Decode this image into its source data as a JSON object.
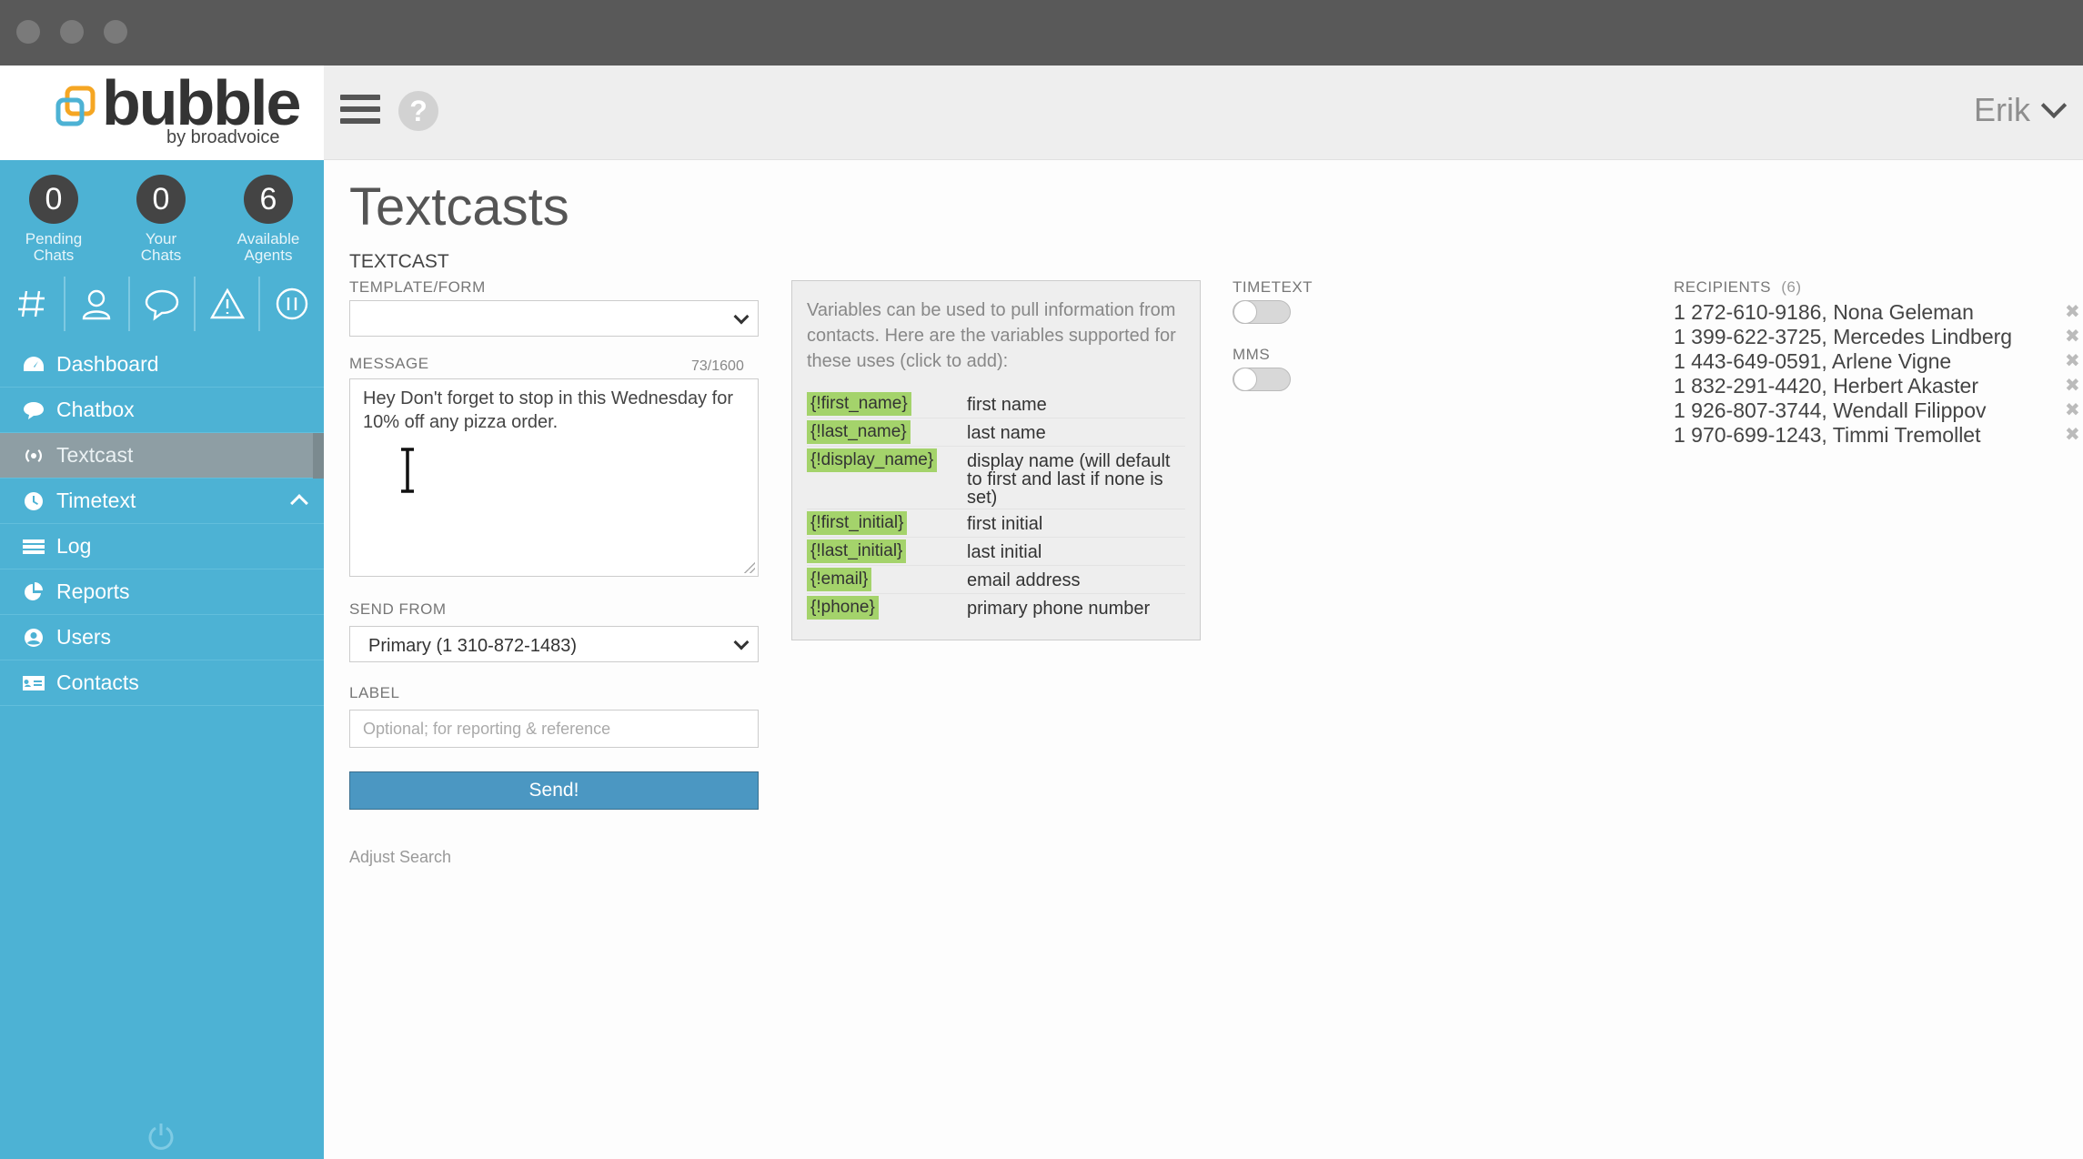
{
  "header": {
    "logo_text": "bubble",
    "logo_sub": "by broadvoice",
    "user_name": "Erik"
  },
  "stats": [
    {
      "count": "0",
      "label_line1": "Pending",
      "label_line2": "Chats"
    },
    {
      "count": "0",
      "label_line1": "Your",
      "label_line2": "Chats"
    },
    {
      "count": "6",
      "label_line1": "Available",
      "label_line2": "Agents"
    }
  ],
  "nav": {
    "items": [
      {
        "label": "Dashboard"
      },
      {
        "label": "Chatbox"
      },
      {
        "label": "Textcast"
      },
      {
        "label": "Timetext"
      },
      {
        "label": "Log"
      },
      {
        "label": "Reports"
      },
      {
        "label": "Users"
      },
      {
        "label": "Contacts"
      }
    ]
  },
  "page": {
    "title": "Textcasts",
    "section": "TEXTCAST",
    "template_label": "TEMPLATE/FORM",
    "template_value": "",
    "message_label": "MESSAGE",
    "message_counter": "73/1600",
    "message_text": "Hey Don't forget to stop in this Wednesday for 10% off any pizza order.",
    "send_from_label": "SEND FROM",
    "send_from_value": "Primary (1 310-872-1483)",
    "label_label": "LABEL",
    "label_placeholder": "Optional; for reporting & reference",
    "send_button": "Send!",
    "adjust_search": "Adjust Search"
  },
  "variables": {
    "intro": "Variables can be used to pull information from contacts. Here are the variables supported for these uses (click to add):",
    "items": [
      {
        "code": "{!first_name}",
        "desc": "first name"
      },
      {
        "code": "{!last_name}",
        "desc": "last name"
      },
      {
        "code": "{!display_name}",
        "desc": "display name (will default to first and last if none is set)"
      },
      {
        "code": "{!first_initial}",
        "desc": "first initial"
      },
      {
        "code": "{!last_initial}",
        "desc": "last initial"
      },
      {
        "code": "{!email}",
        "desc": "email address"
      },
      {
        "code": "{!phone}",
        "desc": "primary phone number"
      }
    ]
  },
  "options": {
    "timetext_label": "TIMETEXT",
    "timetext_on": false,
    "mms_label": "MMS",
    "mms_on": false
  },
  "recipients": {
    "label": "RECIPIENTS",
    "count": "(6)",
    "items": [
      "1 272-610-9186, Nona Geleman",
      "1 399-622-3725, Mercedes Lindberg",
      "1 443-649-0591, Arlene Vigne",
      "1 832-291-4420, Herbert Akaster",
      "1 926-807-3744, Wendall Filippov",
      "1 970-699-1243, Timmi Tremollet"
    ],
    "remove_glyph": "✖"
  },
  "colors": {
    "sidebar": "#4db2d4",
    "active_nav": "#8e9ea4",
    "variable_highlight": "#a4d36b",
    "send_button": "#4b97c2"
  }
}
